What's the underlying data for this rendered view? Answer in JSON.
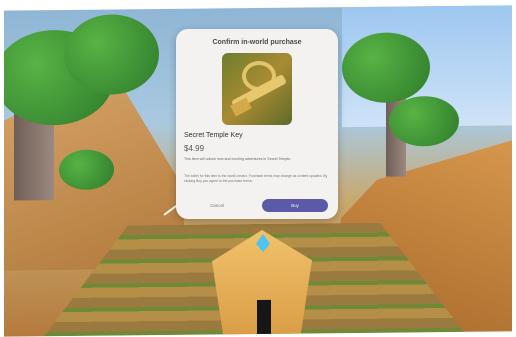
{
  "dialog": {
    "title": "Confirm in-world purchase",
    "item_name": "Secret Temple Key",
    "price": "$4.99",
    "description": "This item will unlock new and exciting adventures in Secret Temple.",
    "fine_print": "The seller for this item is the world creator. Purchase terms may change as content updates. By clicking Buy you agree to the purchase terms.",
    "cancel_label": "Cancel",
    "buy_label": "Buy"
  },
  "colors": {
    "dialog_bg": "#f4f2f1",
    "buy_button": "#5a5aa8"
  },
  "icons": [
    "item-thumbnail-key"
  ]
}
